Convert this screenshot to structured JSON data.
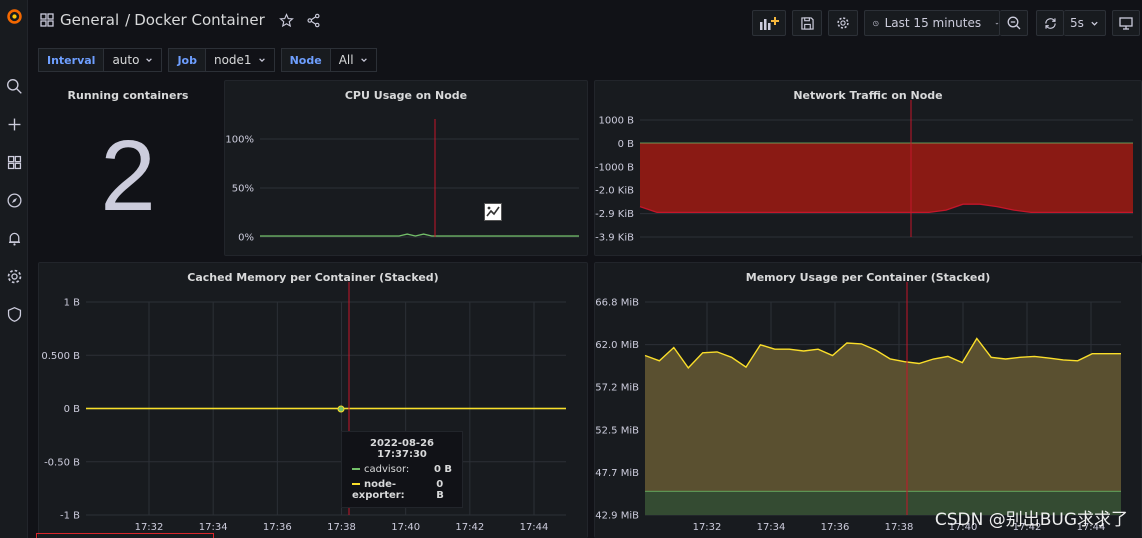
{
  "nav": {
    "breadcrumb_folder": "General",
    "breadcrumb_sep": "/",
    "dashboard_title": "Docker Container"
  },
  "toolbar": {
    "time_range": "Last 15 minutes",
    "refresh_interval": "5s"
  },
  "variables": [
    {
      "label": "Interval",
      "value": "auto"
    },
    {
      "label": "Job",
      "value": "node1"
    },
    {
      "label": "Node",
      "value": "All"
    }
  ],
  "colors": {
    "accent": "#6e9fff",
    "green": "#73bf69",
    "yellow": "#fade2a",
    "red": "#c4162a",
    "olive": "#5a5030"
  },
  "stat_panel": {
    "title": "Running containers",
    "value": "2"
  },
  "tooltip": {
    "time": "2022-08-26 17:37:30",
    "rows": [
      {
        "name": "cadvisor:",
        "value": "0 B",
        "color": "#73bf69"
      },
      {
        "name": "node-exporter:",
        "value": "0 B",
        "color": "#fade2a"
      }
    ]
  },
  "watermark": "CSDN @别出BUG求求了",
  "chart_data": [
    {
      "type": "line",
      "title": "CPU Usage on Node",
      "yticks": [
        "100%",
        "50%",
        "0%"
      ],
      "ylim": [
        0,
        100
      ],
      "series": [
        {
          "values": [
            1,
            1,
            1,
            1,
            1,
            1,
            1,
            1,
            1,
            1,
            1,
            1,
            1,
            1,
            1,
            1,
            1,
            1,
            3,
            1,
            3,
            1,
            1,
            1,
            1,
            1,
            1,
            1,
            1,
            1,
            1,
            1,
            1,
            1,
            1,
            1,
            1,
            1,
            1,
            1
          ]
        }
      ],
      "grid": true
    },
    {
      "type": "area",
      "title": "Network Traffic on Node",
      "yticks": [
        "1000 B",
        "0 B",
        "-1000 B",
        "-2.0 KiB",
        "-2.9 KiB",
        "-3.9 KiB"
      ],
      "ylim": [
        -4000,
        1000
      ],
      "series": [
        {
          "values": [
            0,
            0,
            0,
            0,
            0,
            0,
            0,
            0,
            0,
            0,
            0,
            0,
            0,
            0,
            0,
            0,
            0,
            0,
            0,
            0,
            0,
            0,
            0,
            0,
            0,
            0,
            0,
            0,
            0,
            0
          ]
        },
        {
          "values": [
            -2700,
            -2950,
            -2950,
            -2950,
            -2950,
            -2950,
            -2950,
            -2950,
            -2950,
            -2950,
            -2950,
            -2950,
            -2950,
            -2950,
            -2950,
            -2950,
            -2950,
            -2950,
            -2850,
            -2600,
            -2600,
            -2700,
            -2850,
            -2950,
            -2950,
            -2950,
            -2950,
            -2950,
            -2950,
            -2950
          ]
        }
      ],
      "grid": true
    },
    {
      "type": "line",
      "title": "Cached Memory per Container (Stacked)",
      "yticks": [
        "1 B",
        "0.500 B",
        "0 B",
        "-0.50 B",
        "-1 B"
      ],
      "xticks": [
        "17:32",
        "17:34",
        "17:36",
        "17:38",
        "17:40",
        "17:42",
        "17:44"
      ],
      "ylim": [
        -1,
        1
      ],
      "series": [
        {
          "name": "cadvisor",
          "values": [
            0,
            0,
            0,
            0,
            0,
            0,
            0,
            0
          ]
        },
        {
          "name": "node-exporter",
          "values": [
            0,
            0,
            0,
            0,
            0,
            0,
            0,
            0
          ]
        }
      ],
      "grid": true
    },
    {
      "type": "area",
      "title": "Memory Usage per Container (Stacked)",
      "yticks": [
        "66.8 MiB",
        "62.0 MiB",
        "57.2 MiB",
        "52.5 MiB",
        "47.7 MiB",
        "42.9 MiB"
      ],
      "xticks": [
        "17:32",
        "17:34",
        "17:36",
        "17:38",
        "17:40",
        "17:42",
        "17:44"
      ],
      "ylim": [
        42.9,
        66.8
      ],
      "series": [
        {
          "values": [
            45.6,
            45.6,
            45.6,
            45.6,
            45.6,
            45.6,
            45.6,
            45.6,
            45.6,
            45.6,
            45.6,
            45.6,
            45.6,
            45.6,
            45.6,
            45.6,
            45.6,
            45.6,
            45.6,
            45.6,
            45.6,
            45.6,
            45.6,
            45.6,
            45.6,
            45.6,
            45.6,
            45.6,
            45.6,
            45.6,
            45.6,
            45.6,
            45.6,
            45.6
          ]
        },
        {
          "values": [
            60.8,
            60.2,
            61.7,
            59.4,
            61.1,
            61.2,
            60.6,
            59.5,
            62.0,
            61.5,
            61.5,
            61.3,
            61.5,
            60.8,
            62.2,
            62.1,
            61.4,
            60.4,
            60.1,
            59.9,
            60.4,
            60.7,
            60.0,
            62.7,
            60.6,
            60.4,
            60.6,
            60.7,
            60.5,
            60.3,
            60.2,
            61.0,
            61.0,
            61.0
          ]
        }
      ],
      "grid": true
    }
  ]
}
